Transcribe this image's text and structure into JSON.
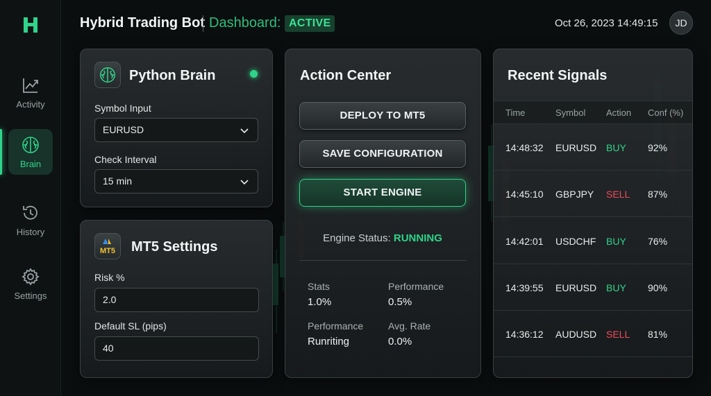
{
  "app": {
    "title": "Hybrid Trading Bot",
    "dashboard_label": "Dashboard:",
    "status": "ACTIVE",
    "datetime": "Oct 26, 2023 14:49:15",
    "user_initials": "JD"
  },
  "sidebar": {
    "items": [
      {
        "label": "Activity",
        "icon": "activity-chart-icon",
        "active": false
      },
      {
        "label": "Brain",
        "icon": "brain-icon",
        "active": true
      },
      {
        "label": "History",
        "icon": "history-icon",
        "active": false
      },
      {
        "label": "Settings",
        "icon": "gear-icon",
        "active": false
      }
    ]
  },
  "python_brain": {
    "title": "Python Brain",
    "online": true,
    "symbol_label": "Symbol Input",
    "symbol_value": "EURUSD",
    "interval_label": "Check Interval",
    "interval_value": "15 min"
  },
  "mt5_settings": {
    "title": "MT5 Settings",
    "logo_text": "MT5",
    "risk_label": "Risk %",
    "risk_value": "2.0",
    "sl_label": "Default SL (pips)",
    "sl_value": "40"
  },
  "action_center": {
    "title": "Action Center",
    "deploy_label": "DEPLOY TO MT5",
    "save_label": "SAVE CONFIGURATION",
    "start_label": "START ENGINE",
    "engine_status_label": "Engine Status:",
    "engine_status_value": "RUNNING",
    "stats": [
      {
        "label": "Stats",
        "value": "1.0%"
      },
      {
        "label": "Performance",
        "value": "0.5%"
      },
      {
        "label": "Performance",
        "value": "Runriting"
      },
      {
        "label": "Avg. Rate",
        "value": "0.0%"
      }
    ]
  },
  "recent_signals": {
    "title": "Recent Signals",
    "columns": [
      "Time",
      "Symbol",
      "Action",
      "Conf (%)"
    ],
    "rows": [
      {
        "time": "14:48:32",
        "symbol": "EURUSD",
        "action": "BUY",
        "conf": "92%"
      },
      {
        "time": "14:45:10",
        "symbol": "GBPJPY",
        "action": "SELL",
        "conf": "87%"
      },
      {
        "time": "14:42:01",
        "symbol": "USDCHF",
        "action": "BUY",
        "conf": "76%"
      },
      {
        "time": "14:39:55",
        "symbol": "EURUSD",
        "action": "BUY",
        "conf": "90%"
      },
      {
        "time": "14:36:12",
        "symbol": "AUDUSD",
        "action": "SELL",
        "conf": "81%"
      }
    ]
  },
  "colors": {
    "accent": "#2fd48a",
    "buy": "#2fd48a",
    "sell": "#ef4c5a",
    "background": "#0b0e0f"
  }
}
